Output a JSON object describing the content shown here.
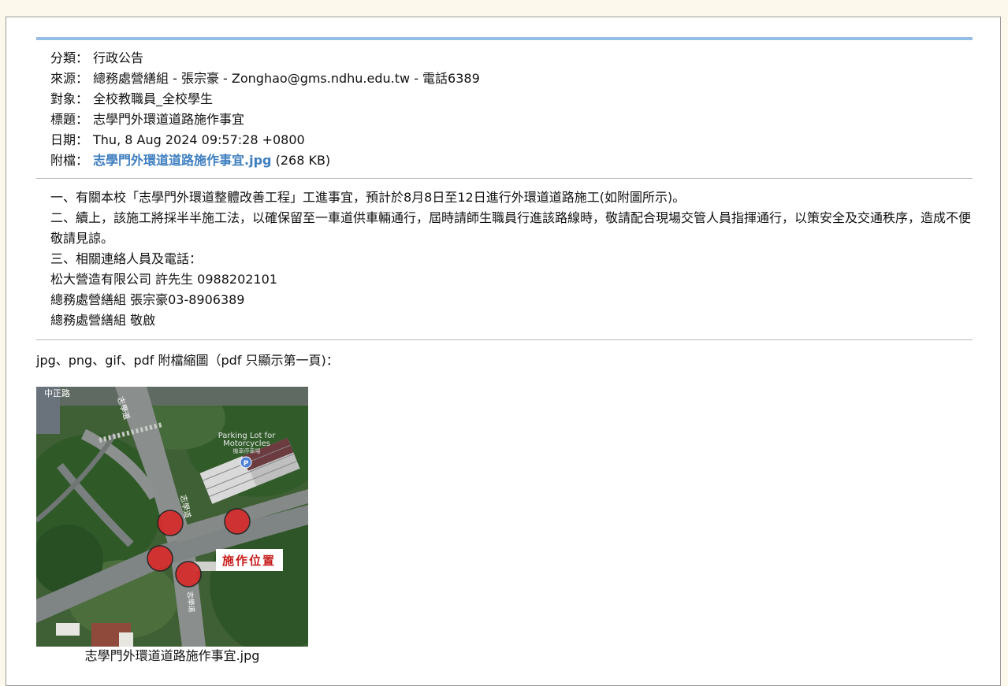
{
  "header": {
    "category": {
      "label": "分類：",
      "value": "行政公告"
    },
    "source": {
      "label": "來源：",
      "value": "總務處營繕組 - 張宗豪 - Zonghao@gms.ndhu.edu.tw - 電話6389"
    },
    "audience": {
      "label": "對象：",
      "value": "全校教職員_全校學生"
    },
    "subject": {
      "label": "標題：",
      "value": "志學門外環道道路施作事宜"
    },
    "date": {
      "label": "日期：",
      "value": "Thu, 8 Aug 2024 09:57:28 +0800"
    },
    "attachment": {
      "label": "附檔：",
      "filename": "志學門外環道道路施作事宜.jpg",
      "size": "(268 KB)"
    }
  },
  "body": {
    "lines": [
      "一、有關本校「志學門外環道整體改善工程」工進事宜，預計於8月8日至12日進行外環道道路施工(如附圖所示)。",
      "二、續上，該施工將採半半施工法，以確保留至一車道供車輛通行，屆時請師生職員行進該路線時，敬請配合現場交管人員指揮通行，以策安全及交通秩序，造成不便敬請見諒。",
      "三、相關連絡人員及電話：",
      "松大營造有限公司 許先生 0988202101",
      "總務處營繕組 張宗豪03-8906389",
      "總務處營繕組  敬啟"
    ]
  },
  "thumbnails": {
    "heading": "jpg、png、gif、pdf 附檔縮圖（pdf 只顯示第一頁)：",
    "caption": "志學門外環道道路施作事宜.jpg",
    "map": {
      "road_label_top_left": "中正路",
      "road_label_vertical_top": "志學道",
      "road_label_vertical_mid": "志學道",
      "road_label_vertical_bottom": "志學道",
      "parking_line1": "Parking Lot for",
      "parking_line2": "Motorcycles",
      "parking_line3": "機車停車場",
      "parking_icon": "P",
      "work_label": "施作位置"
    }
  },
  "colors": {
    "accent_bar": "#96bde3",
    "link": "#3f7fc0",
    "page_background": "#fdf8ec",
    "marker_red": "#d62b2b",
    "work_label_red": "#c81e1e"
  }
}
